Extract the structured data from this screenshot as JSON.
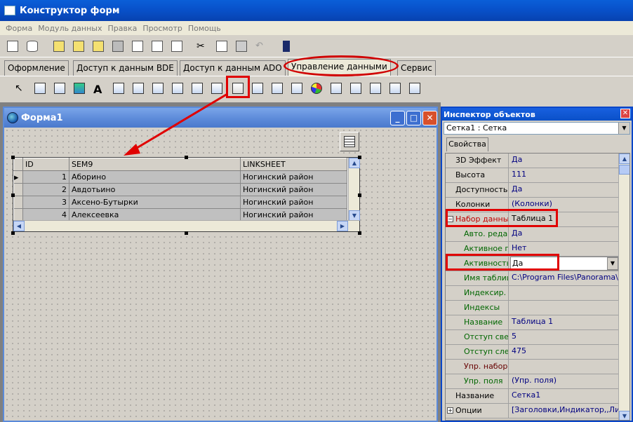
{
  "app": {
    "title": "Конструктор форм"
  },
  "menu": [
    "Форма",
    "Модуль данных",
    "Правка",
    "Просмотр",
    "Помощь"
  ],
  "tabs": [
    {
      "label": "Оформление"
    },
    {
      "label": "Доступ к данным BDE"
    },
    {
      "label": "Доступ к данным ADO"
    },
    {
      "label": "Управление данными"
    },
    {
      "label": "Сервис"
    }
  ],
  "form": {
    "title": "Форма1",
    "grid": {
      "columns": [
        "ID",
        "SEM9",
        "LINKSHEET"
      ],
      "rows": [
        {
          "id": "1",
          "name": "Аборино",
          "link": "Ногинский район"
        },
        {
          "id": "2",
          "name": "Авдотьино",
          "link": "Ногинский район"
        },
        {
          "id": "3",
          "name": "Аксено-Бутырки",
          "link": "Ногинский район"
        },
        {
          "id": "4",
          "name": "Алексеевка",
          "link": "Ногинский район"
        }
      ]
    }
  },
  "inspector": {
    "title": "Инспектор объектов",
    "object": "Сетка1 : Сетка",
    "tab": "Свойства",
    "props": [
      {
        "name": "3D Эффект",
        "value": "Да"
      },
      {
        "name": "Высота",
        "value": "111"
      },
      {
        "name": "Доступность",
        "value": "Да"
      },
      {
        "name": "Колонки",
        "value": "(Колонки)"
      },
      {
        "name": "Набор данных",
        "value": "Таблица 1"
      },
      {
        "name": "Авто. редак-",
        "value": "Да"
      },
      {
        "name": "Активное по",
        "value": "Нет"
      },
      {
        "name": "Активность",
        "value": "Да"
      },
      {
        "name": "Имя таблиц",
        "value": "C:\\Program Files\\Panorama\\P"
      },
      {
        "name": "Индексир. п",
        "value": ""
      },
      {
        "name": "Индексы",
        "value": ""
      },
      {
        "name": "Название",
        "value": "Таблица 1"
      },
      {
        "name": "Отступ свер",
        "value": "5"
      },
      {
        "name": "Отступ слев",
        "value": "475"
      },
      {
        "name": "Упр. набор д",
        "value": ""
      },
      {
        "name": "Упр. поля",
        "value": "(Упр. поля)"
      },
      {
        "name": "Название",
        "value": "Сетка1"
      },
      {
        "name": "Опции",
        "value": "[Заголовки,Индикатор,,Лини"
      }
    ]
  },
  "icons": {
    "app": "window-icon",
    "form": "globe-icon",
    "selected_tool": "dbgrid-tool-icon",
    "nonvisual": "table-component-icon"
  },
  "colors": {
    "annotation": "#e00000",
    "titlebar": "#0850c8"
  }
}
